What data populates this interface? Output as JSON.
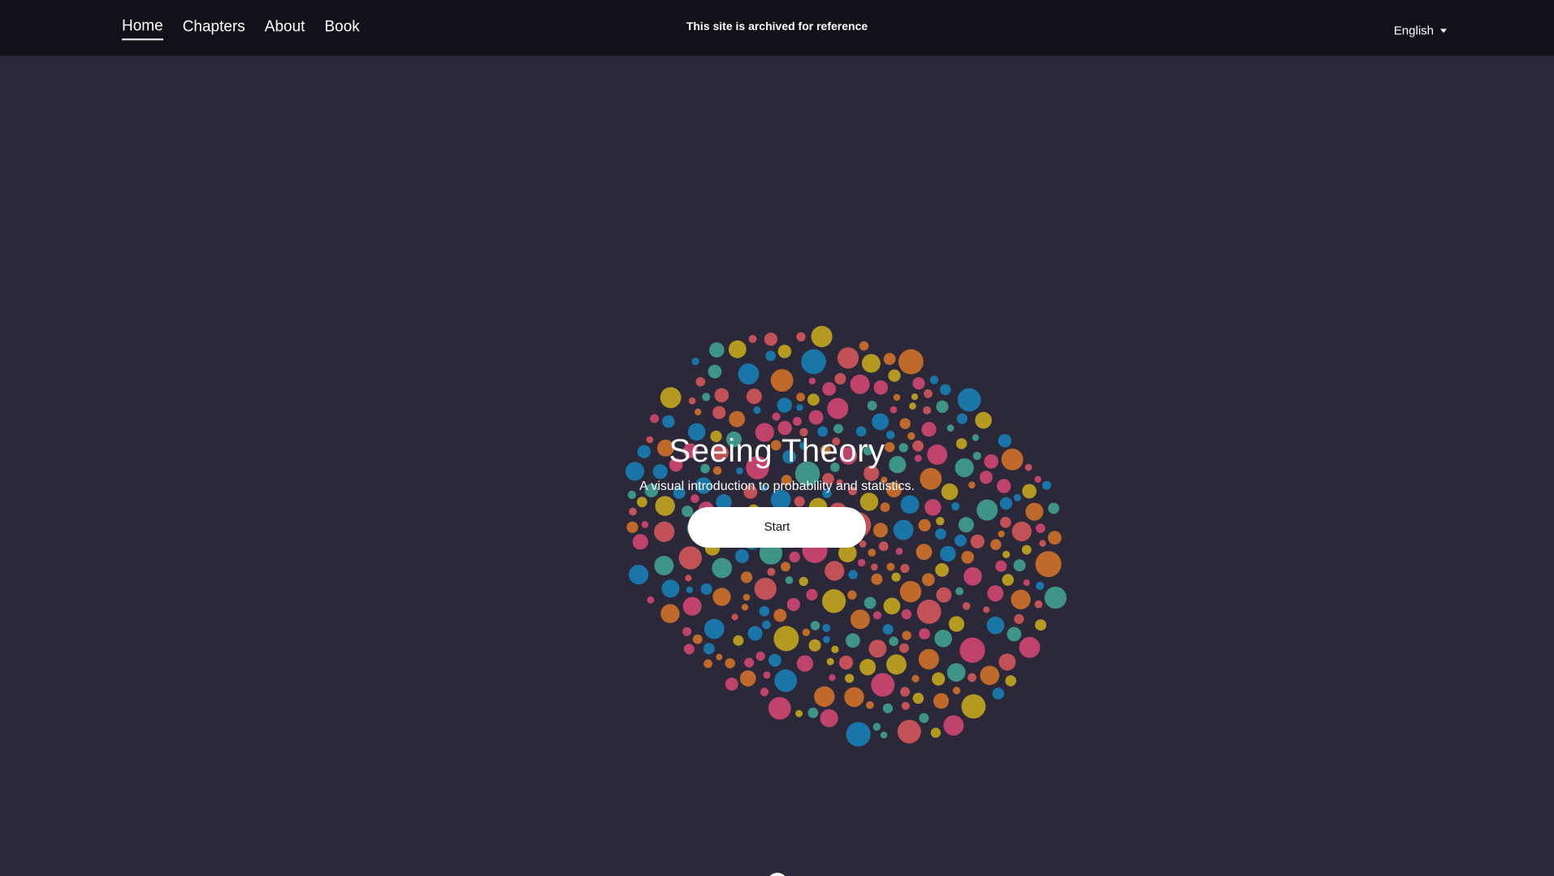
{
  "header": {
    "nav": [
      {
        "label": "Home",
        "active": true
      },
      {
        "label": "Chapters",
        "active": false
      },
      {
        "label": "About",
        "active": false
      },
      {
        "label": "Book",
        "active": false
      }
    ],
    "notice": "This site is archived for reference",
    "language": "English"
  },
  "hero": {
    "title": "Seeing Theory",
    "subtitle": "A visual introduction to probability and statistics.",
    "start_label": "Start"
  },
  "colors": {
    "background": "#2a2839",
    "header_bg": "#12111a",
    "bubble_palette": [
      "#c0436b",
      "#1a76a8",
      "#3e9486",
      "#b59a22",
      "#bf6a2b",
      "#c25258"
    ]
  }
}
